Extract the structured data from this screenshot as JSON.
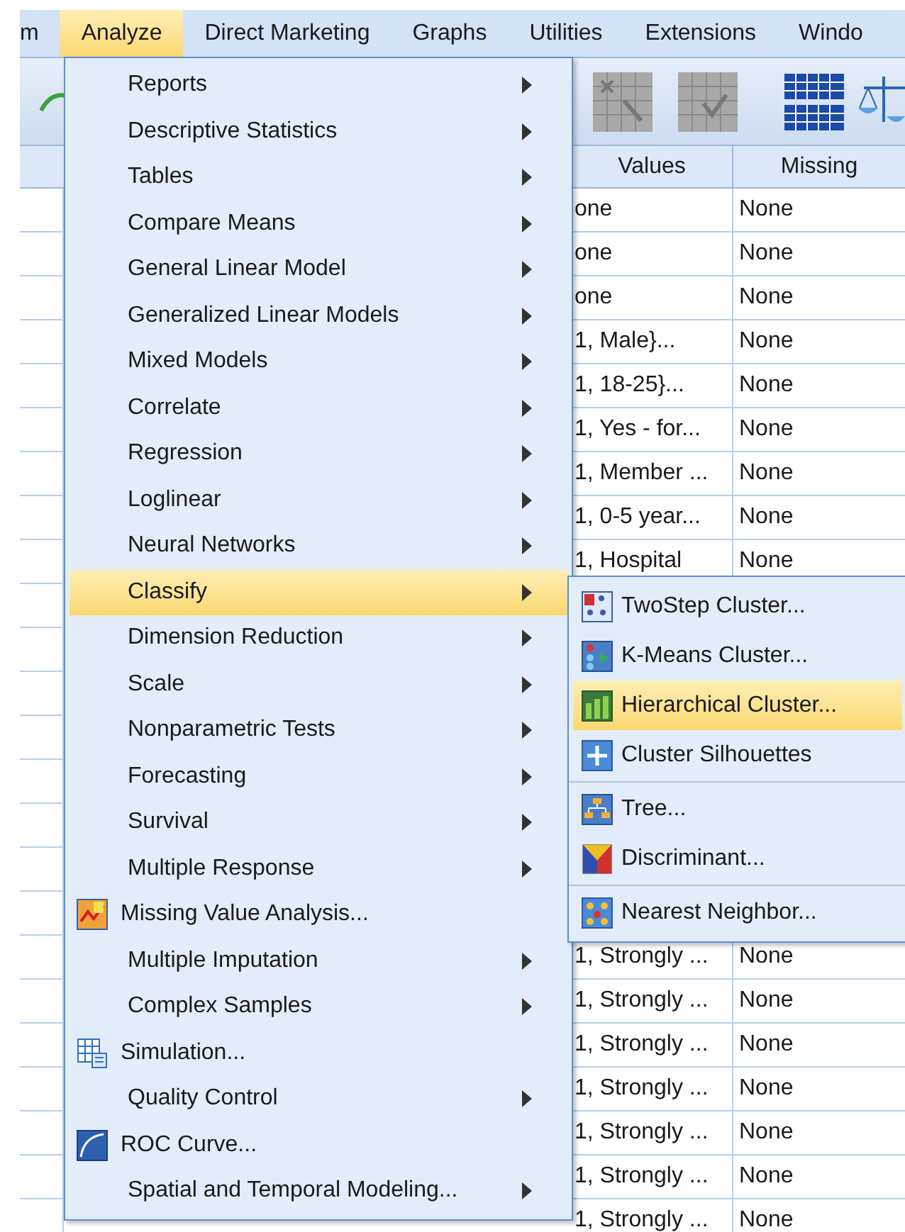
{
  "menubar": [
    {
      "label": "m",
      "selected": false
    },
    {
      "label": "Analyze",
      "selected": true
    },
    {
      "label": "Direct Marketing",
      "selected": false
    },
    {
      "label": "Graphs",
      "selected": false
    },
    {
      "label": "Utilities",
      "selected": false
    },
    {
      "label": "Extensions",
      "selected": false
    },
    {
      "label": "Windo",
      "selected": false
    }
  ],
  "table": {
    "columns": [
      "Values",
      "Missing"
    ],
    "rows_top": [
      [
        "one",
        "None"
      ],
      [
        "one",
        "None"
      ],
      [
        "one",
        "None"
      ],
      [
        "1, Male}...",
        "None"
      ],
      [
        "1, 18-25}...",
        "None"
      ],
      [
        "1, Yes - for...",
        "None"
      ],
      [
        "1, Member ...",
        "None"
      ],
      [
        "1, 0-5 year...",
        "None"
      ],
      [
        "1, Hospital",
        "None"
      ]
    ],
    "rows_bottom": [
      [
        "1, Strongly ...",
        "None"
      ],
      [
        "1, Strongly ...",
        "None"
      ],
      [
        "1, Strongly ...",
        "None"
      ],
      [
        "1, Strongly ...",
        "None"
      ],
      [
        "1, Strongly ...",
        "None"
      ],
      [
        "1, Strongly ...",
        "None"
      ],
      [
        "1, Strongly ...",
        "None"
      ]
    ]
  },
  "analyze_menu": [
    {
      "label": "Reports",
      "kind": "submenu",
      "selected": false
    },
    {
      "label": "Descriptive Statistics",
      "kind": "submenu",
      "selected": false
    },
    {
      "label": "Tables",
      "kind": "submenu",
      "selected": false
    },
    {
      "label": "Compare Means",
      "kind": "submenu",
      "selected": false
    },
    {
      "label": "General Linear Model",
      "kind": "submenu",
      "selected": false
    },
    {
      "label": "Generalized Linear Models",
      "kind": "submenu",
      "selected": false
    },
    {
      "label": "Mixed Models",
      "kind": "submenu",
      "selected": false
    },
    {
      "label": "Correlate",
      "kind": "submenu",
      "selected": false
    },
    {
      "label": "Regression",
      "kind": "submenu",
      "selected": false
    },
    {
      "label": "Loglinear",
      "kind": "submenu",
      "selected": false
    },
    {
      "label": "Neural Networks",
      "kind": "submenu",
      "selected": false
    },
    {
      "label": "Classify",
      "kind": "submenu",
      "selected": true
    },
    {
      "label": "Dimension Reduction",
      "kind": "submenu",
      "selected": false
    },
    {
      "label": "Scale",
      "kind": "submenu",
      "selected": false
    },
    {
      "label": "Nonparametric Tests",
      "kind": "submenu",
      "selected": false
    },
    {
      "label": "Forecasting",
      "kind": "submenu",
      "selected": false
    },
    {
      "label": "Survival",
      "kind": "submenu",
      "selected": false
    },
    {
      "label": "Multiple Response",
      "kind": "submenu",
      "selected": false
    },
    {
      "label": "Missing Value Analysis...",
      "kind": "action",
      "selected": false
    },
    {
      "label": "Multiple Imputation",
      "kind": "submenu",
      "selected": false
    },
    {
      "label": "Complex Samples",
      "kind": "submenu",
      "selected": false
    },
    {
      "label": "Simulation...",
      "kind": "action",
      "selected": false
    },
    {
      "label": "Quality Control",
      "kind": "submenu",
      "selected": false
    },
    {
      "label": "ROC Curve...",
      "kind": "action",
      "selected": false
    },
    {
      "label": "Spatial and Temporal Modeling...",
      "kind": "submenu",
      "selected": false
    }
  ],
  "classify_menu": [
    [
      {
        "label": "TwoStep Cluster...",
        "selected": false
      },
      {
        "label": "K-Means Cluster...",
        "selected": false
      },
      {
        "label": "Hierarchical Cluster...",
        "selected": true
      },
      {
        "label": "Cluster Silhouettes",
        "selected": false
      }
    ],
    [
      {
        "label": "Tree...",
        "selected": false
      },
      {
        "label": "Discriminant...",
        "selected": false
      }
    ],
    [
      {
        "label": "Nearest Neighbor...",
        "selected": false
      }
    ]
  ]
}
